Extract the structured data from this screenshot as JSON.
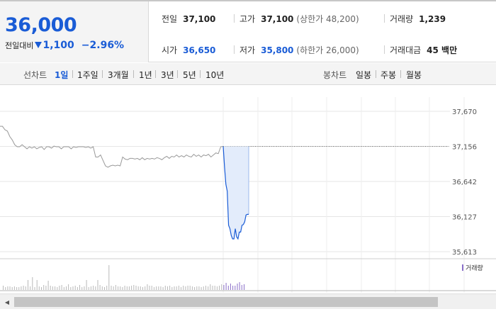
{
  "quote": {
    "price": "36,000",
    "change_label": "전일대비",
    "change_value": "1,100",
    "change_pct": "−2.96%",
    "stats": {
      "prev_label": "전일",
      "prev_value": "37,100",
      "high_label": "고가",
      "high_value": "37,100",
      "upper_limit": "(상한가 48,200)",
      "volume_label": "거래량",
      "volume_value": "1,239",
      "open_label": "시가",
      "open_value": "36,650",
      "low_label": "저가",
      "low_value": "35,800",
      "lower_limit": "(하한가 26,000)",
      "amount_label": "거래대금",
      "amount_value": "45 백만"
    }
  },
  "colors": {
    "accent_blue": "#1a5cd6",
    "volume_purple": "#8a6fc9",
    "line_gray": "#999999",
    "fill_blue": "#e3ecfb"
  },
  "tabs": {
    "line_chart_label": "선차트",
    "line_periods": [
      "1일",
      "1주일",
      "3개월",
      "1년",
      "3년",
      "5년",
      "10년"
    ],
    "active_period": "1일",
    "candle_chart_label": "봉차트",
    "candle_periods": [
      "일봉",
      "주봉",
      "월봉"
    ]
  },
  "chart_data": {
    "type": "line",
    "ylim": [
      35613,
      37670
    ],
    "yticks": [
      "37,670",
      "37,156",
      "36,642",
      "36,127",
      "35,613"
    ],
    "reference_line": {
      "value": 37156
    },
    "series": [
      {
        "values": [
          37450,
          37450,
          37400,
          37380,
          37300,
          37250,
          37180,
          37150,
          37150,
          37180,
          37150,
          37120,
          37150,
          37130,
          37150,
          37120,
          37140,
          37150,
          37110,
          37150,
          37150,
          37130,
          37160,
          37150,
          37150,
          37120,
          37150,
          37150,
          37150,
          37120,
          37150,
          37140,
          37150,
          37150,
          37150,
          37140,
          37150,
          37130,
          37150,
          37000,
          37000,
          37030,
          36950,
          36870,
          36850,
          36870,
          36880,
          36870,
          36880,
          36870,
          37000,
          36970,
          36960,
          36980,
          36980,
          36970,
          36980,
          36960,
          36990,
          36960,
          36980,
          36970,
          36980,
          36970,
          36990,
          36980,
          36960,
          36990,
          37010,
          36980,
          37010,
          37000,
          37030,
          37000,
          37020,
          37000,
          37030,
          37010,
          37000,
          37040,
          37010,
          37030,
          37000,
          37030,
          37020,
          37040,
          37000,
          37030,
          37060,
          37050,
          37150,
          37156
        ]
      },
      {
        "values": [
          37156,
          36850,
          36600,
          36500,
          36000,
          35950,
          35850,
          35800,
          35800,
          35950,
          35830,
          35800,
          35900,
          35900,
          36000,
          36010,
          36050,
          36150,
          36160,
          36160
        ]
      }
    ],
    "volume": [
      6,
      4,
      5,
      5,
      4,
      5,
      4,
      4,
      5,
      6,
      5,
      14,
      5,
      18,
      4,
      14,
      5,
      4,
      7,
      6,
      13,
      6,
      5,
      5,
      4,
      6,
      7,
      4,
      5,
      8,
      4,
      5,
      6,
      4,
      7,
      4,
      5,
      14,
      4,
      5,
      6,
      5,
      14,
      7,
      5,
      4,
      6,
      35,
      6,
      5,
      7,
      5,
      5,
      4,
      6,
      5,
      5,
      6,
      7,
      6,
      5,
      5,
      4,
      5,
      8,
      6,
      6,
      4,
      5,
      5,
      5,
      4,
      6,
      5,
      6,
      4,
      5,
      5,
      6,
      4,
      6,
      5,
      6,
      6,
      5,
      4,
      5,
      5,
      4,
      5,
      6,
      5,
      8,
      6,
      6,
      5,
      6,
      8,
      7,
      10,
      6,
      9,
      6,
      6,
      9,
      11,
      7,
      8
    ]
  },
  "volume_legend": "거래량"
}
